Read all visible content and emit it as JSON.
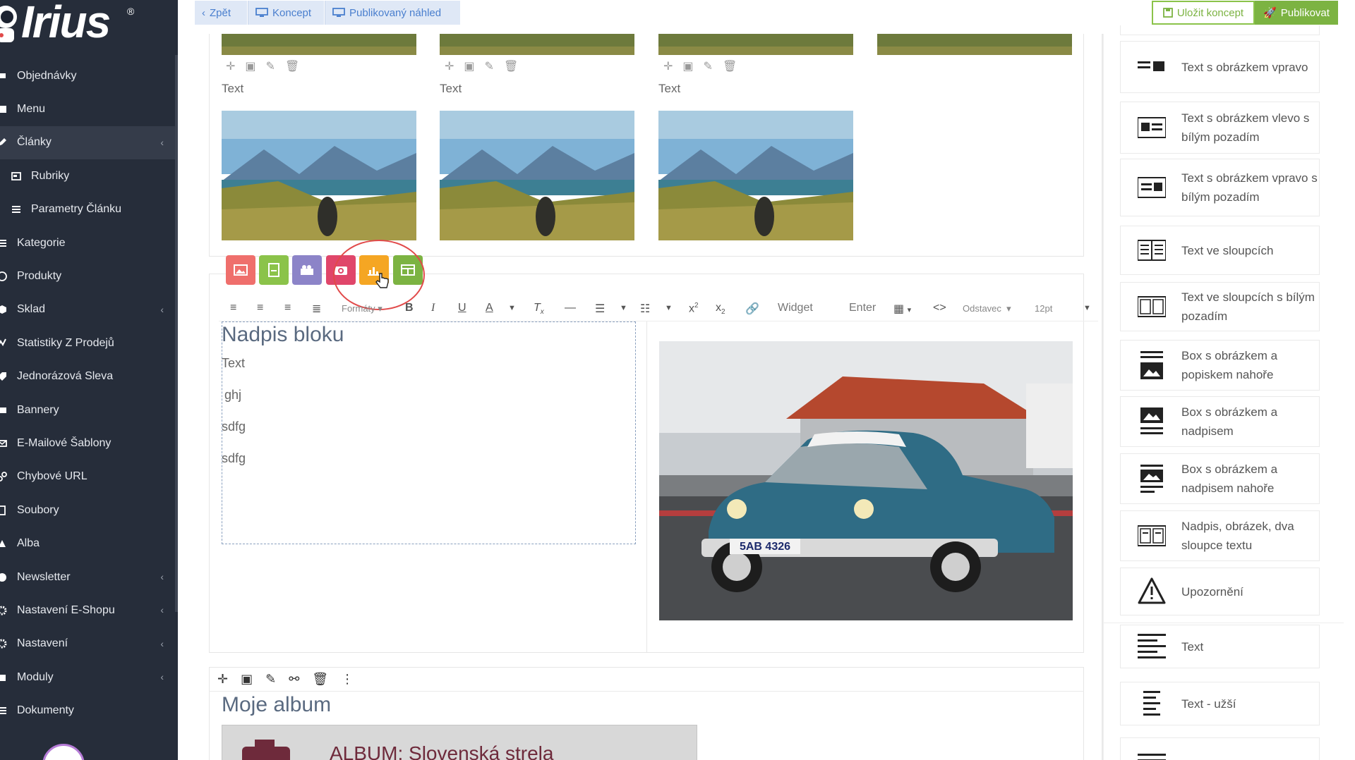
{
  "app": {
    "logo": "Irius",
    "logo_mark": "®"
  },
  "topbar": {
    "back": "Zpět",
    "draft": "Koncept",
    "published_preview": "Publikovaný náhled",
    "save_draft": "Uložit koncept",
    "publish": "Publikovat"
  },
  "sidebar": {
    "items": [
      {
        "label": "Objednávky",
        "icon": "cart-icon",
        "chevron": false
      },
      {
        "label": "Menu",
        "icon": "menu-icon",
        "chevron": false
      },
      {
        "label": "Články",
        "icon": "pencil-icon",
        "chevron": true,
        "active": true
      },
      {
        "label": "Rubriky",
        "icon": "image-icon",
        "chevron": false,
        "sub": true
      },
      {
        "label": "Parametry Článku",
        "icon": "sliders-icon",
        "chevron": false,
        "sub": true
      },
      {
        "label": "Kategorie",
        "icon": "list-icon",
        "chevron": false
      },
      {
        "label": "Produkty",
        "icon": "cube-icon",
        "chevron": false
      },
      {
        "label": "Sklad",
        "icon": "box-icon",
        "chevron": true
      },
      {
        "label": "Statistiky Z Prodejů",
        "icon": "chart-icon",
        "chevron": false
      },
      {
        "label": "Jednorázová Sleva",
        "icon": "tag-icon",
        "chevron": false
      },
      {
        "label": "Bannery",
        "icon": "banner-icon",
        "chevron": false
      },
      {
        "label": "E-Mailové Šablony",
        "icon": "mail-icon",
        "chevron": false
      },
      {
        "label": "Chybové URL",
        "icon": "link-icon",
        "chevron": false
      },
      {
        "label": "Soubory",
        "icon": "file-icon",
        "chevron": false
      },
      {
        "label": "Alba",
        "icon": "album-icon",
        "chevron": false
      },
      {
        "label": "Newsletter",
        "icon": "newsletter-icon",
        "chevron": true
      },
      {
        "label": "Nastavení E-Shopu",
        "icon": "gear-icon",
        "chevron": true
      },
      {
        "label": "Nastavení",
        "icon": "gear-icon",
        "chevron": true
      },
      {
        "label": "Moduly",
        "icon": "puzzle-icon",
        "chevron": true
      },
      {
        "label": "Dokumenty",
        "icon": "doc-icon",
        "chevron": false
      }
    ]
  },
  "editor": {
    "gallery_captions": [
      "Text",
      "Text",
      "Text"
    ],
    "block_heading": "Nadpis bloku",
    "block_paragraphs": [
      "Text",
      "ghj",
      "sdfg",
      "sdfg"
    ],
    "toolbar": {
      "formats": "Formáty",
      "widget": "Widget",
      "enter": "Enter",
      "paragraph": "Odstavec",
      "font_size": "12pt"
    },
    "album_title": "Moje album",
    "album_banner": "ALBUM: Slovenská strela",
    "insert_buttons": [
      {
        "name": "insert-image-button",
        "color": "#ef6f6c"
      },
      {
        "name": "insert-file-button",
        "color": "#8bc34a"
      },
      {
        "name": "insert-video-button",
        "color": "#8c84c8"
      },
      {
        "name": "insert-photo-button",
        "color": "#e0466a"
      },
      {
        "name": "insert-chart-button",
        "color": "#f5a623"
      },
      {
        "name": "insert-table-button",
        "color": "#7cb342"
      }
    ]
  },
  "widgets": [
    {
      "label": "Text s obrázkem vpravo",
      "icon": "text-image-right-icon"
    },
    {
      "label": "Text s obrázkem vlevo s bílým pozadím",
      "icon": "text-image-left-white-icon"
    },
    {
      "label": "Text s obrázkem vpravo s bílým pozadím",
      "icon": "text-image-right-white-icon"
    },
    {
      "label": "Text ve sloupcích",
      "icon": "columns-icon"
    },
    {
      "label": "Text ve sloupcích s bílým pozadím",
      "icon": "columns-white-icon"
    },
    {
      "label": "Box s obrázkem a popiskem nahoře",
      "icon": "box-caption-top-icon"
    },
    {
      "label": "Box s obrázkem a nadpisem",
      "icon": "box-heading-icon"
    },
    {
      "label": "Box s obrázkem a nadpisem nahoře",
      "icon": "box-heading-top-icon"
    },
    {
      "label": "Nadpis, obrázek, dva sloupce textu",
      "icon": "heading-image-columns-icon"
    },
    {
      "label": "Upozornění",
      "icon": "warning-icon"
    },
    {
      "label": "Text",
      "icon": "text-icon"
    },
    {
      "label": "Text - užší",
      "icon": "text-narrow-icon"
    }
  ]
}
